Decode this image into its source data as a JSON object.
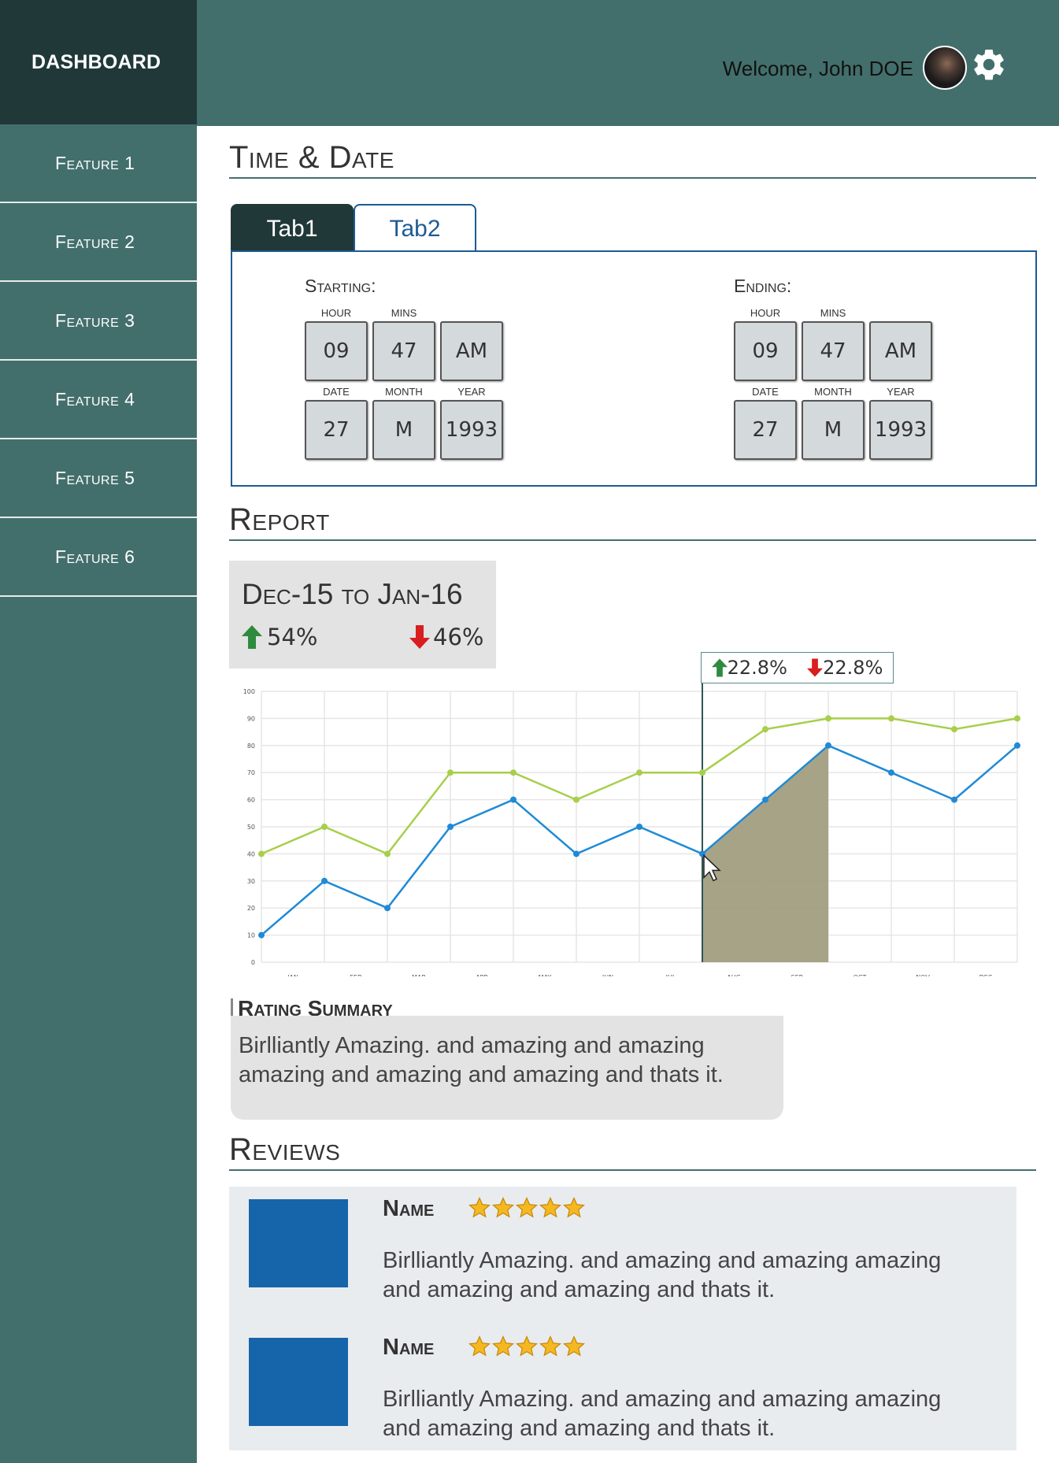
{
  "app": {
    "brand": "DASHBOARD"
  },
  "sidebar": {
    "items": [
      {
        "label": "Feature 1"
      },
      {
        "label": "Feature 2"
      },
      {
        "label": "Feature 3"
      },
      {
        "label": "Feature 4"
      },
      {
        "label": "Feature 5"
      },
      {
        "label": "Feature 6"
      }
    ]
  },
  "header": {
    "welcome": "Welcome, John DOE",
    "avatar_icon": "user-avatar",
    "settings_icon": "gear-icon"
  },
  "time_date": {
    "title": "Time & Date",
    "tabs": [
      {
        "label": "Tab1",
        "active": true
      },
      {
        "label": "Tab2",
        "active": false
      }
    ],
    "starting": {
      "heading": "Starting:",
      "hour_label": "HOUR",
      "mins_label": "MINS",
      "date_label": "DATE",
      "month_label": "MONTH",
      "year_label": "YEAR",
      "hour": "09",
      "mins": "47",
      "ampm": "AM",
      "date": "27",
      "month": "M",
      "year": "1993"
    },
    "ending": {
      "heading": "Ending:",
      "hour_label": "HOUR",
      "mins_label": "MINS",
      "date_label": "DATE",
      "month_label": "MONTH",
      "year_label": "YEAR",
      "hour": "09",
      "mins": "47",
      "ampm": "AM",
      "date": "27",
      "month": "M",
      "year": "1993"
    }
  },
  "report": {
    "title": "Report",
    "range": "Dec-15 to Jan-16",
    "up_pct": "54%",
    "down_pct": "46%",
    "tooltip_up": "22.8%",
    "tooltip_down": "22.8%",
    "colors": {
      "up": "#2e8b3e",
      "down": "#d81e1e",
      "series_green": "#a7cf4b",
      "series_blue": "#1f8ad6",
      "area": "#a29e80"
    }
  },
  "chart_data": {
    "type": "line",
    "categories": [
      "JAN",
      "FEB",
      "MAR",
      "APR",
      "MAY",
      "JUN",
      "JUL",
      "AUG",
      "SEP",
      "OCT",
      "NOV",
      "DEC"
    ],
    "series": [
      {
        "values": [
          40,
          50,
          40,
          70,
          70,
          60,
          70,
          70,
          86,
          90,
          90,
          86,
          90
        ]
      },
      {
        "values": [
          10,
          30,
          20,
          50,
          60,
          40,
          50,
          40,
          60,
          80,
          70,
          60,
          80
        ]
      }
    ],
    "ylim": [
      0,
      100
    ],
    "yticks": [
      0,
      10,
      20,
      30,
      40,
      50,
      60,
      70,
      80,
      90,
      100
    ],
    "grid": true,
    "highlight": {
      "from_index": 7,
      "to_index": 9
    }
  },
  "rating": {
    "title": "Rating Summary",
    "text": "Birlliantly Amazing. and amazing and amazing amazing and amazing and amazing and thats it."
  },
  "reviews": {
    "title": "Reviews",
    "items": [
      {
        "name": "Name",
        "stars": 5,
        "text": "Birlliantly Amazing. and amazing and amazing amazing and amazing and amazing and thats it."
      },
      {
        "name": "Name",
        "stars": 5,
        "text": "Birlliantly Amazing. and amazing and amazing amazing and amazing and amazing and thats it."
      }
    ]
  }
}
